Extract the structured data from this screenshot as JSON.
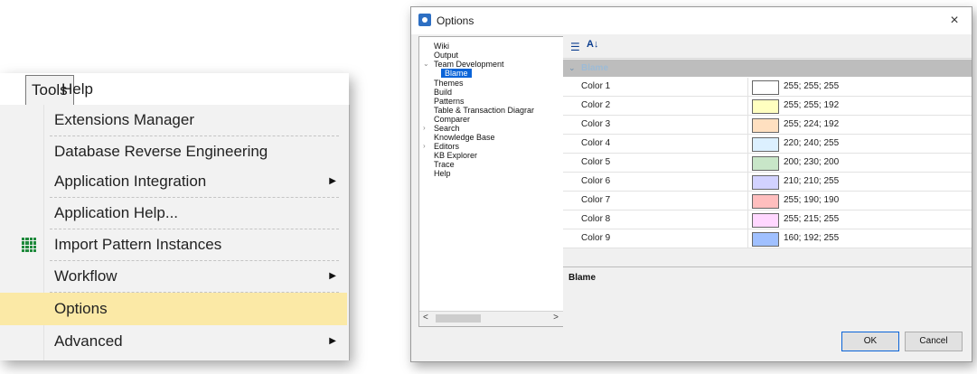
{
  "menu": {
    "menubar": {
      "tools": "Tools",
      "help": "Help"
    },
    "items": [
      {
        "label": "Extensions Manager"
      },
      {
        "label": "Database Reverse Engineering"
      },
      {
        "label": "Application Integration",
        "submenu": true
      },
      {
        "label": "Application Help..."
      },
      {
        "label": "Import Pattern Instances",
        "icon": "pattern-grid-icon"
      },
      {
        "label": "Workflow",
        "submenu": true
      },
      {
        "label": "Options",
        "highlighted": true
      },
      {
        "label": "Advanced",
        "submenu": true
      }
    ]
  },
  "dialog": {
    "title": "Options",
    "close": "×",
    "tree": [
      "Wiki",
      "Output",
      "Team Development",
      "Blame",
      "Themes",
      "Build",
      "Patterns",
      "Table & Transaction Diagrar",
      "Comparer",
      "Search",
      "Knowledge Base",
      "Editors",
      "KB Explorer",
      "Trace",
      "Help"
    ],
    "tree_scroll": {
      "left": "<",
      "right": ">"
    },
    "toolbar": {
      "categorized": "categorized-icon",
      "alphabetical": "sort-az-icon"
    },
    "category": "Blame",
    "properties": [
      {
        "name": "Color 1",
        "value": "255; 255; 255",
        "color": "#ffffff"
      },
      {
        "name": "Color 2",
        "value": "255; 255; 192",
        "color": "#ffffc0"
      },
      {
        "name": "Color 3",
        "value": "255; 224; 192",
        "color": "#ffe0c0"
      },
      {
        "name": "Color 4",
        "value": "220; 240; 255",
        "color": "#dcf0ff"
      },
      {
        "name": "Color 5",
        "value": "200; 230; 200",
        "color": "#c8e6c8"
      },
      {
        "name": "Color 6",
        "value": "210; 210; 255",
        "color": "#d2d2ff"
      },
      {
        "name": "Color 7",
        "value": "255; 190; 190",
        "color": "#ffbebe"
      },
      {
        "name": "Color 8",
        "value": "255; 215; 255",
        "color": "#ffd7ff"
      },
      {
        "name": "Color 9",
        "value": "160; 192; 255",
        "color": "#a0c0ff"
      }
    ],
    "description_title": "Blame",
    "buttons": {
      "ok": "OK",
      "cancel": "Cancel"
    }
  },
  "colors": {
    "highlight": "#fbe9a6",
    "selection": "#0a64d8",
    "category_row": "#bdbdbd"
  }
}
